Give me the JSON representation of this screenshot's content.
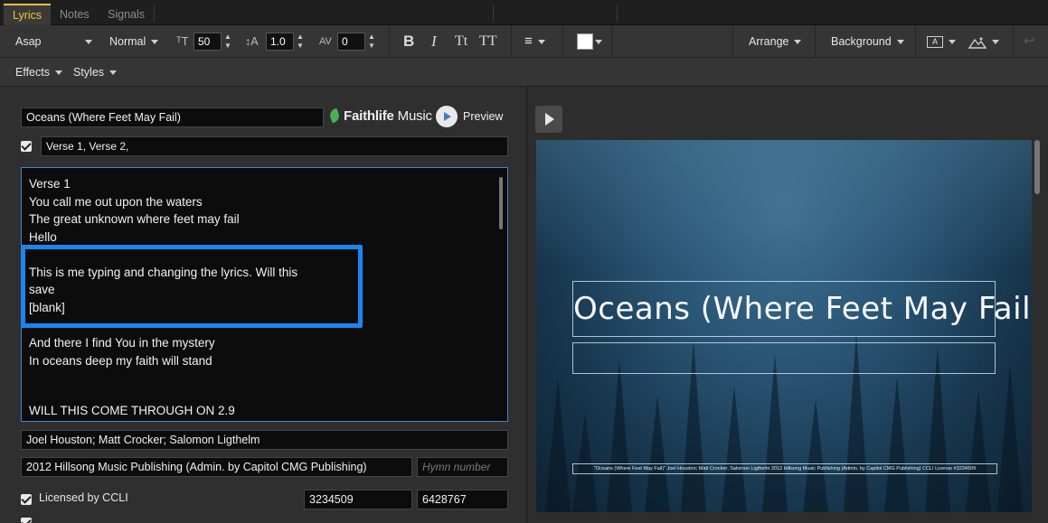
{
  "tabs": [
    {
      "label": "Lyrics",
      "active": true
    },
    {
      "label": "Notes",
      "active": false
    },
    {
      "label": "Signals",
      "active": false
    }
  ],
  "toolbar": {
    "font_family": "Asap",
    "font_weight": "Normal",
    "font_size": "50",
    "line_height": "1.0",
    "letter_spacing": "0",
    "bold_icon": "B",
    "italic_icon": "I",
    "small_caps_icon": "Tt",
    "all_caps_icon": "TT",
    "text_color": "#ffffff",
    "arrange_label": "Arrange",
    "background_label": "Background"
  },
  "toolbar2": {
    "effects_label": "Effects",
    "styles_label": "Styles"
  },
  "song": {
    "title": "Oceans (Where Feet May Fail)",
    "brand_bold": "Faithlife",
    "brand_light": "Music",
    "preview_label": "Preview",
    "sections": "Verse 1, Verse 2,",
    "lyrics": [
      "Verse 1",
      "You call me out upon the waters",
      "The great unknown where feet may fail",
      "Hello",
      "",
      "This is me typing and changing the lyrics. Will this",
      "save",
      "[blank]",
      "",
      "And there I find You in the mystery",
      "In oceans deep my faith will stand",
      "",
      "",
      "WILL THIS COME THROUGH ON 2.9"
    ],
    "authors": "Joel Houston; Matt Crocker; Salomon Ligthelm",
    "copyright": "2012 Hillsong Music Publishing (Admin. by Capitol CMG Publishing)",
    "hymn_placeholder": "Hymn number",
    "licensed_label": "Licensed by CCLI",
    "ccli_number": "3234509",
    "license_number": "6428767"
  },
  "slide": {
    "title": "Oceans (Where Feet May Fail)",
    "footer": "\"Oceans (Where Feet May Fail)\" Joel Houston; Matt Crocker; Salomon Ligthelm 2012 Hillsong Music Publishing (Admin. by Capitol CMG Publishing) CCLI License #3234509"
  },
  "colors": {
    "accent_tab": "#f3c13a",
    "focus_border": "#3d86d4",
    "highlight": "#1a86f0",
    "brand_leaf": "#4caf50"
  }
}
